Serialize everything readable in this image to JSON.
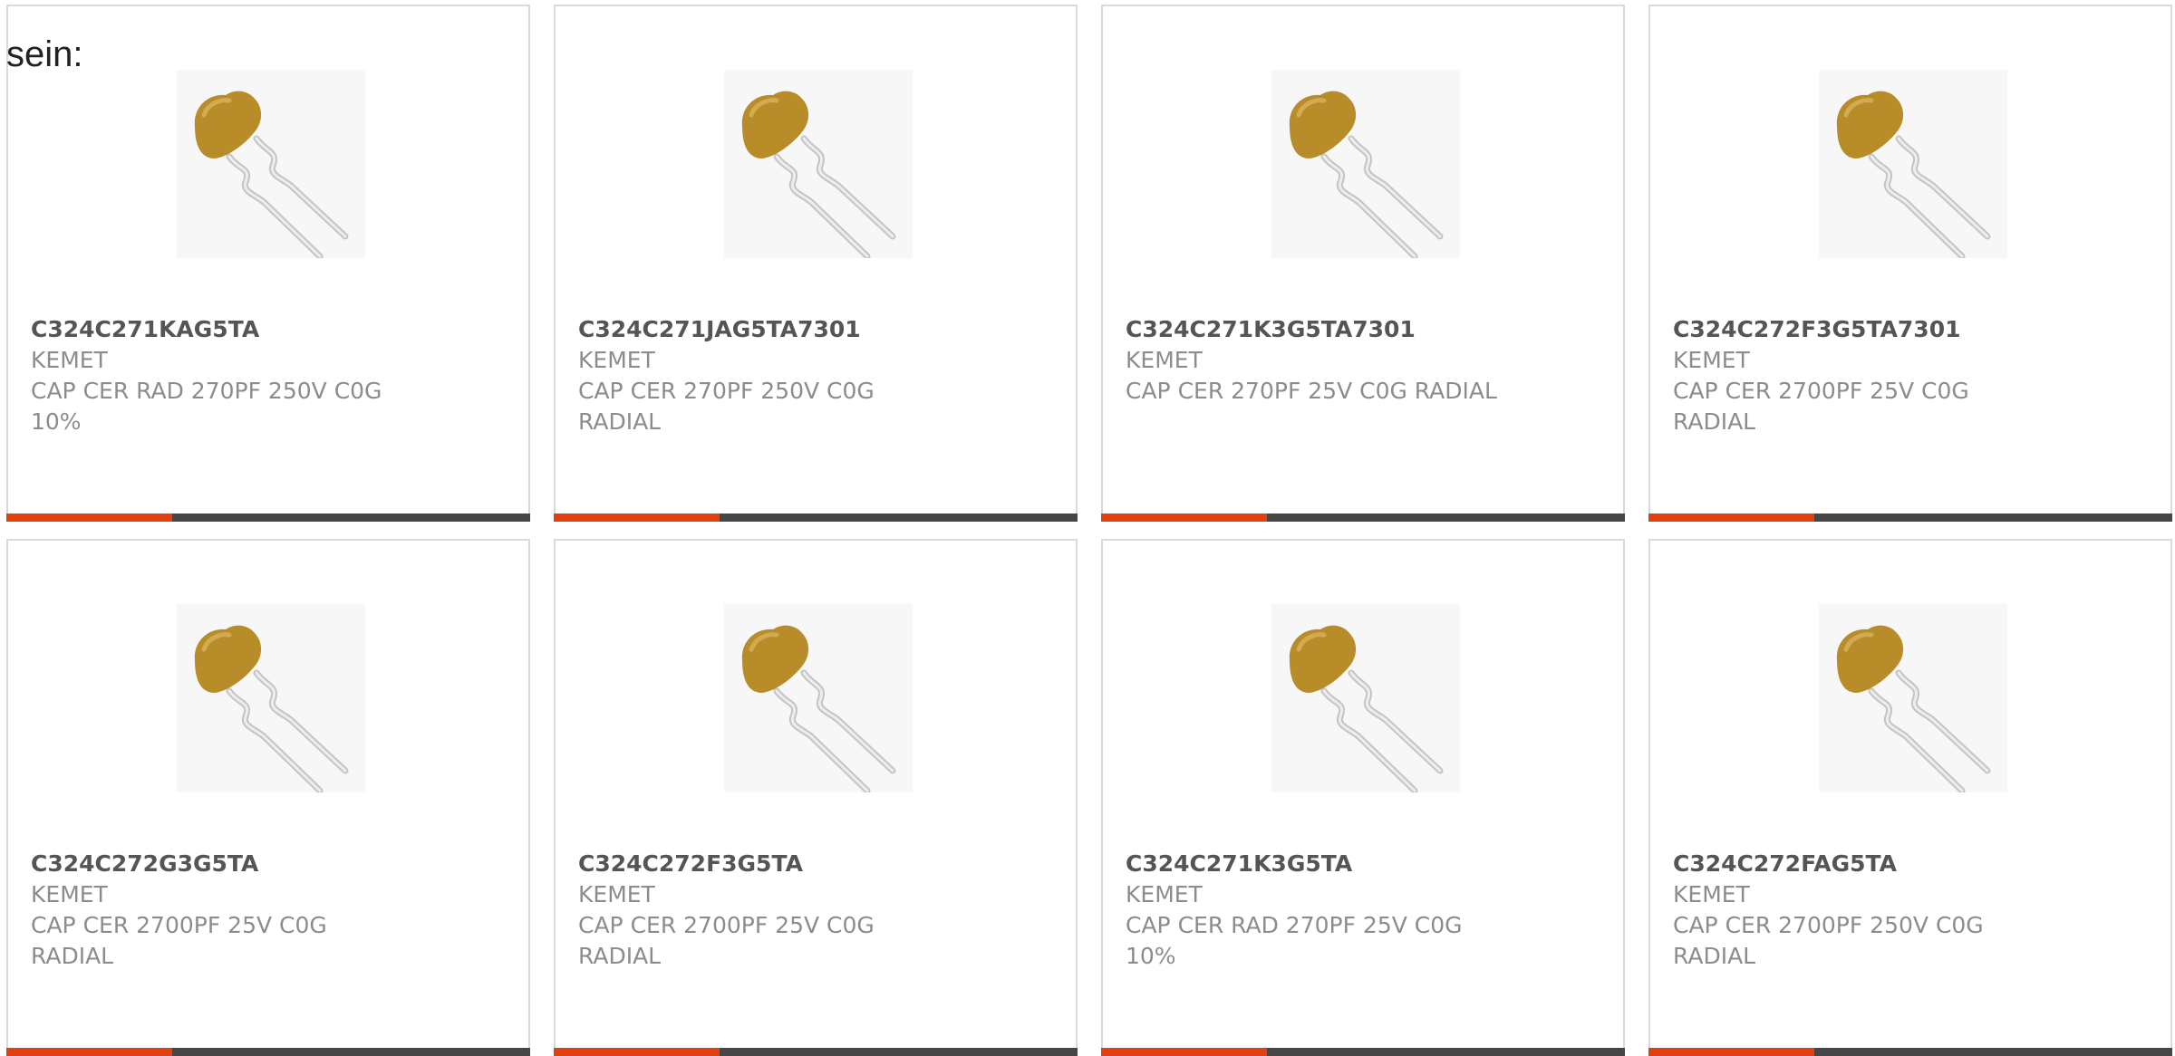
{
  "intro_text": "sein:",
  "colors": {
    "accent": "#e3400f",
    "bar": "#464646",
    "border": "#d9d9d9",
    "capacitor_body": "#b98c2a",
    "lead": "#cfcfcf"
  },
  "products": [
    {
      "part_number": "C324C271KAG5TA",
      "manufacturer": "KEMET",
      "description": "CAP CER RAD 270PF 250V C0G\n10%",
      "image_icon": "radial-ceramic-capacitor-icon"
    },
    {
      "part_number": "C324C271JAG5TA7301",
      "manufacturer": "KEMET",
      "description": "CAP CER 270PF 250V C0G\nRADIAL",
      "image_icon": "radial-ceramic-capacitor-icon"
    },
    {
      "part_number": "C324C271K3G5TA7301",
      "manufacturer": "KEMET",
      "description": "CAP CER 270PF 25V C0G RADIAL",
      "image_icon": "radial-ceramic-capacitor-icon"
    },
    {
      "part_number": "C324C272F3G5TA7301",
      "manufacturer": "KEMET",
      "description": "CAP CER 2700PF 25V C0G\nRADIAL",
      "image_icon": "radial-ceramic-capacitor-icon"
    },
    {
      "part_number": "C324C272G3G5TA",
      "manufacturer": "KEMET",
      "description": "CAP CER 2700PF 25V C0G\nRADIAL",
      "image_icon": "radial-ceramic-capacitor-icon"
    },
    {
      "part_number": "C324C272F3G5TA",
      "manufacturer": "KEMET",
      "description": "CAP CER 2700PF 25V C0G\nRADIAL",
      "image_icon": "radial-ceramic-capacitor-icon"
    },
    {
      "part_number": "C324C271K3G5TA",
      "manufacturer": "KEMET",
      "description": "CAP CER RAD 270PF 25V C0G\n10%",
      "image_icon": "radial-ceramic-capacitor-icon"
    },
    {
      "part_number": "C324C272FAG5TA",
      "manufacturer": "KEMET",
      "description": "CAP CER 2700PF 250V C0G\nRADIAL",
      "image_icon": "radial-ceramic-capacitor-icon"
    }
  ]
}
